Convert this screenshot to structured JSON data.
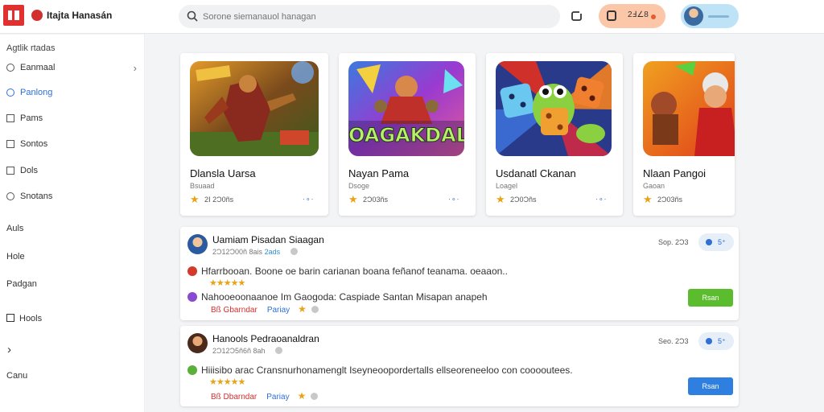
{
  "header": {
    "brand": "Itajta Hanasán",
    "search_placeholder": "Sorone siemanauol hanagan",
    "coins": "2Ⅎ∠8",
    "colors": {
      "brand": "#e03030",
      "coin_pill": "#fbc7a8",
      "user_pill": "#bfe3f6"
    }
  },
  "sidebar": {
    "title": "Agtlik rtadas",
    "items": [
      {
        "label": "Eanmaal",
        "icon": "target-icon",
        "chevron": "›"
      },
      {
        "label": "Panlong",
        "icon": "pin-icon",
        "active": true
      },
      {
        "label": "Pams",
        "icon": "list-icon"
      },
      {
        "label": "Sontos",
        "icon": "box-icon"
      },
      {
        "label": "Dols",
        "icon": "doc-icon"
      },
      {
        "label": "Snotans",
        "icon": "gear-icon"
      }
    ],
    "sections": [
      "Auls",
      "Hole",
      "Padgan",
      "Hools",
      "Canu"
    ],
    "arrow": "›"
  },
  "games": [
    {
      "title": "Dlansla Uarsa",
      "sub": "Bsuaad",
      "count": "2Ⅰ 2Ɔ0ñs",
      "more": "·∘∙",
      "art": "warrior"
    },
    {
      "title": "Nayan Pama",
      "sub": "Dsoge",
      "count": "2Ɔ03ñs",
      "more": "·∘∙",
      "art": "oagakdal",
      "art_text": "OAGAKDAL"
    },
    {
      "title": "Usdanatl Ckanan",
      "sub": "Loagel",
      "count": "2Ɔ0Ɔñs",
      "more": "·∘∙",
      "art": "dice"
    },
    {
      "title": "Nlaan Pangoi",
      "sub": "Gaoan",
      "count": "2Ɔ03ñs",
      "more": "·∘∙",
      "art": "runner"
    }
  ],
  "reviews": [
    {
      "name": "Uamiam Pisadan Siaagan",
      "meta": "2Ɔ12Ɔ00ñ 8ais",
      "tag": "2ads",
      "date": "Sop. 2Ɔ3",
      "votes": "5⁺",
      "line1": "Hfarrbooan. Boone oe barin carianan boana feñanof teanama. oeaaon..",
      "line2": "Nahooeoonaanoe Im Gaogoda: Caspiade Santan Misapan anapeh",
      "foot_red": "Bß Gbarndar",
      "foot_blue": "Pariay",
      "button": "Rsan",
      "button_color": "#5bbd2d",
      "stars": "★★★★★"
    },
    {
      "name": "Hanools Pedraoanaldran",
      "meta": "2Ɔ12Ɔ5ñ6ñ 8ah",
      "tag": "",
      "date": "Seo. 2Ɔ3",
      "votes": "5⁺",
      "line1": "Hiiisibo arac Cransnurhonamenglt Iseyneoopordertalls ellseoreneeloo con cooooutees.",
      "line2": "",
      "foot_red": "Bß Dbarndar",
      "foot_blue": "Pariay",
      "button": "Rsan",
      "button_color": "#2f7fe0",
      "stars": "★★★★★"
    }
  ]
}
